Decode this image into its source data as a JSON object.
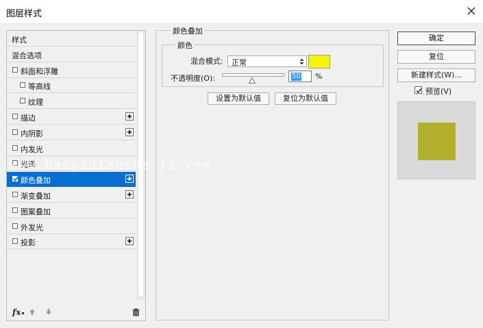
{
  "window": {
    "title": "图层样式"
  },
  "style_list": {
    "items": [
      {
        "label": "样式",
        "checkbox": false,
        "checked": false,
        "plus": false,
        "indent": 0,
        "active": false
      },
      {
        "label": "混合选项",
        "checkbox": false,
        "checked": false,
        "plus": false,
        "indent": 0,
        "active": false
      },
      {
        "label": "斜面和浮雕",
        "checkbox": true,
        "checked": false,
        "plus": false,
        "indent": 0,
        "active": false
      },
      {
        "label": "等高线",
        "checkbox": true,
        "checked": false,
        "plus": false,
        "indent": 1,
        "active": false
      },
      {
        "label": "纹理",
        "checkbox": true,
        "checked": false,
        "plus": false,
        "indent": 1,
        "active": false
      },
      {
        "label": "描边",
        "checkbox": true,
        "checked": false,
        "plus": true,
        "indent": 0,
        "active": false
      },
      {
        "label": "内阴影",
        "checkbox": true,
        "checked": false,
        "plus": true,
        "indent": 0,
        "active": false
      },
      {
        "label": "内发光",
        "checkbox": true,
        "checked": false,
        "plus": false,
        "indent": 0,
        "active": false
      },
      {
        "label": "光泽",
        "checkbox": true,
        "checked": false,
        "plus": false,
        "indent": 0,
        "active": false
      },
      {
        "label": "颜色叠加",
        "checkbox": true,
        "checked": true,
        "plus": true,
        "indent": 0,
        "active": true
      },
      {
        "label": "渐变叠加",
        "checkbox": true,
        "checked": false,
        "plus": true,
        "indent": 0,
        "active": false
      },
      {
        "label": "图案叠加",
        "checkbox": true,
        "checked": false,
        "plus": false,
        "indent": 0,
        "active": false
      },
      {
        "label": "外发光",
        "checkbox": true,
        "checked": false,
        "plus": false,
        "indent": 0,
        "active": false
      },
      {
        "label": "投影",
        "checkbox": true,
        "checked": false,
        "plus": true,
        "indent": 0,
        "active": false
      }
    ],
    "toolbar": {
      "fx_label": "fx"
    }
  },
  "color_overlay": {
    "section_title": "颜色叠加",
    "group_title": "颜色",
    "blend_mode_label": "混合模式:",
    "blend_mode_value": "正常",
    "swatch_color": "#f5f500",
    "opacity_label": "不透明度(O):",
    "opacity_value": "50",
    "opacity_unit": "%",
    "set_default_label": "设置为默认值",
    "reset_default_label": "复位为默认值"
  },
  "actions": {
    "ok_label": "确定",
    "reset_label": "复位",
    "new_style_label": "新建样式(W)...",
    "preview_label": "预览(V)",
    "preview_checked": true
  },
  "preview": {
    "color": "#b1b12d"
  },
  "watermark": {
    "text": "www.haoyidianshe ji.com"
  },
  "colors": {
    "accent": "#0a6ed1",
    "background": "#f0f0f0"
  }
}
